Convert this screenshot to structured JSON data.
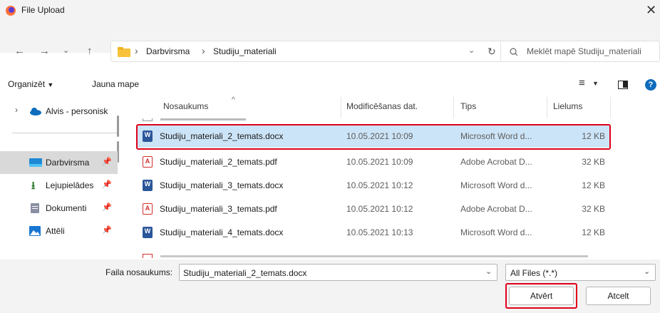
{
  "window": {
    "title": "File Upload"
  },
  "address": {
    "crumbs": [
      "Darbvirsma",
      "Studiju_materiali"
    ]
  },
  "search": {
    "placeholder": "Meklēt mapē Studiju_materiali"
  },
  "toolbar": {
    "organize": "Organizēt",
    "new_folder": "Jauna mape"
  },
  "sidebar": {
    "items": [
      {
        "label": "Alvis - personisk"
      },
      {
        "label": "Darbvirsma"
      },
      {
        "label": "Lejupielādes"
      },
      {
        "label": "Dokumenti"
      },
      {
        "label": "Attēli"
      }
    ]
  },
  "columns": {
    "name": "Nosaukums",
    "modified": "Modificēšanas dat.",
    "type": "Tips",
    "size": "Lielums"
  },
  "files": [
    {
      "name": "Studiju_materiali_2_temats.docx",
      "modified": "10.05.2021 10:09",
      "type": "Microsoft Word d...",
      "size": "12 KB"
    },
    {
      "name": "Studiju_materiali_2_temats.pdf",
      "modified": "10.05.2021 10:09",
      "type": "Adobe Acrobat D...",
      "size": "32 KB"
    },
    {
      "name": "Studiju_materiali_3_temats.docx",
      "modified": "10.05.2021 10:12",
      "type": "Microsoft Word d...",
      "size": "12 KB"
    },
    {
      "name": "Studiju_materiali_3_temats.pdf",
      "modified": "10.05.2021 10:12",
      "type": "Adobe Acrobat D...",
      "size": "32 KB"
    },
    {
      "name": "Studiju_materiali_4_temats.docx",
      "modified": "10.05.2021 10:13",
      "type": "Microsoft Word d...",
      "size": "12 KB"
    }
  ],
  "footer": {
    "filename_label": "Faila nosaukums:",
    "filename_value": "Studiju_materiali_2_temats.docx",
    "filter_value": "All Files (*.*)",
    "open_label": "Atvērt",
    "cancel_label": "Atcelt"
  },
  "colors": {
    "selection": "#cce4f7",
    "highlight": "#e0001a",
    "accent": "#0f6cbd"
  }
}
